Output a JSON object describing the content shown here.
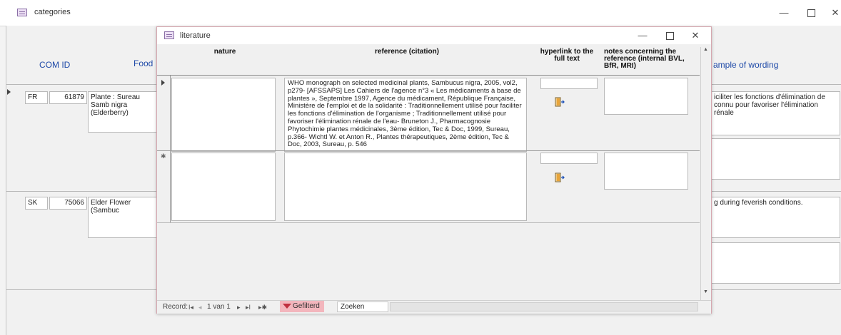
{
  "outer": {
    "title": "categories",
    "controls": {
      "minimize": "—",
      "close": "✕"
    },
    "headers": {
      "com_id": "COM ID",
      "food": "Food",
      "example": "ample of wording"
    },
    "records": [
      {
        "country": "FR",
        "id": "61879",
        "food": "Plante : Sureau Samb nigra (Elderberry)",
        "example": "iciliter les fonctions d'élimination de connu pour favoriser l'élimination rénale"
      },
      {
        "country": "SK",
        "id": "75066",
        "food": "Elder Flower (Sambuc",
        "example": "g during feverish conditions."
      }
    ]
  },
  "inner": {
    "title": "literature",
    "controls": {
      "minimize": "—",
      "close": "✕"
    },
    "columns": {
      "nature": "nature",
      "reference": "reference (citation)",
      "hyperlink": "hyperlink to the full text",
      "notes": "notes concerning the reference (internal BVL, BfR, MRI)"
    },
    "rows": [
      {
        "nature": "",
        "reference": "WHO monograph on selected medicinal plants, Sambucus nigra, 2005, vol2, p279- [AFSSAPS] Les Cahiers de l'agence n°3 « Les médicaments à base de plantes », Septembre 1997, Agence du médicament, République Française, Ministère de l'emploi et de la solidarité : Traditionnellement utilisé pour faciliter les fonctions d'élimination de l'organisme ; Traditionnellement utilisé pour favoriser l'élimination rénale de l'eau- Bruneton J., Pharmacognosie Phytochimie plantes médicinales, 3ème édition, Tec & Doc, 1999, Sureau, p.366- Wichtl W. et Anton R., Plantes thérapeutiques, 2ème édition, Tec & Doc, 2003, Sureau, p. 546",
        "hyperlink": "",
        "notes": ""
      },
      {
        "nature": "",
        "reference": "",
        "hyperlink": "",
        "notes": ""
      }
    ],
    "new_row_marker": "✱",
    "nav": {
      "record_label": "Record:",
      "first": "I◂",
      "prev": "◂",
      "position": "1 van 1",
      "next": "▸",
      "last": "▸I",
      "new": "▸✱",
      "filter": "Gefilterd",
      "search": "Zoeken"
    }
  }
}
